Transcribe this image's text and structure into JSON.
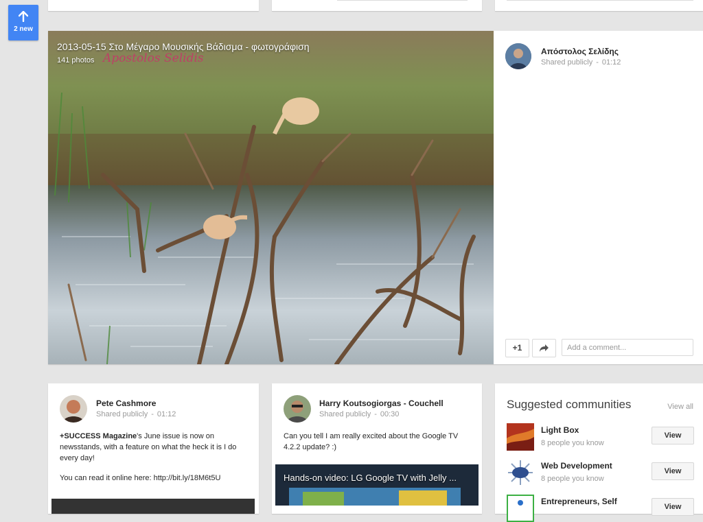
{
  "new_posts": {
    "label": "2 new"
  },
  "photo_post": {
    "album_title": "2013-05-15 Στο Μέγαρο Μουσικής Βάδισμα - φωτογράφιση",
    "album_count": "141 photos",
    "watermark": "Apostolos Selidis",
    "author": "Απόστολος Σελίδης",
    "visibility": "Shared publicly",
    "time": "01:12",
    "plus_one_label": "+1",
    "comment_placeholder": "Add a comment..."
  },
  "posts": [
    {
      "author": "Pete Cashmore",
      "visibility": "Shared publicly",
      "time": "01:12",
      "text_bold": "+SUCCESS Magazine",
      "text_rest": "'s June issue is now on newsstands, with a feature on what the heck it is I do every day!",
      "link_line": "You can read it online here: http://bit.ly/18M6t5U"
    },
    {
      "author": "Harry Koutsogiorgas - Couchell",
      "visibility": "Shared publicly",
      "time": "00:30",
      "text": "Can you tell I am really excited about the Google TV 4.2.2 update? :)",
      "video_title": "Hands-on video: LG Google TV with Jelly ..."
    }
  ],
  "suggested": {
    "title": "Suggested communities",
    "view_all": "View all",
    "communities": [
      {
        "name": "Light Box",
        "meta": "8 people you know",
        "button": "View"
      },
      {
        "name": "Web Development",
        "meta": "8 people you know",
        "button": "View"
      },
      {
        "name": "Entrepreneurs, Self",
        "meta": "",
        "button": "View"
      }
    ]
  },
  "colors": {
    "accent": "#4285f4",
    "background": "#e5e5e5",
    "watermark": "#c8336a"
  }
}
